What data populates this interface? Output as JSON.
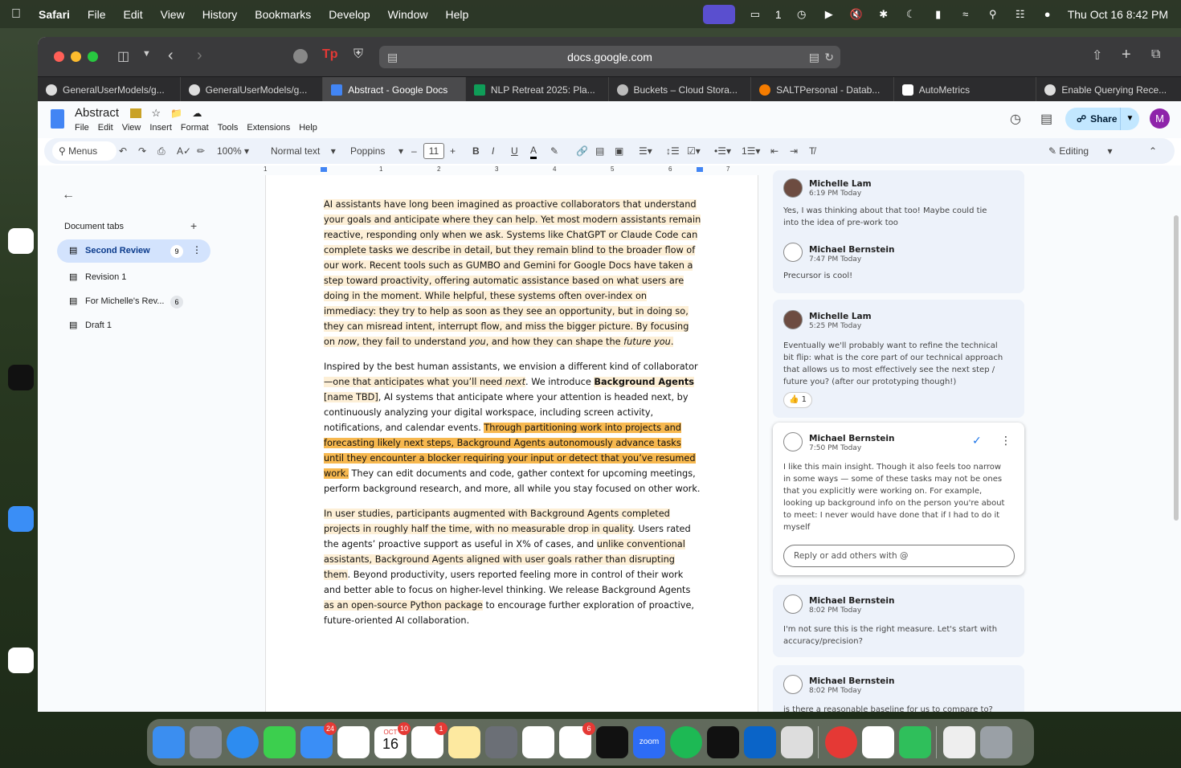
{
  "menubar": {
    "app": "Safari",
    "items": [
      "File",
      "Edit",
      "View",
      "History",
      "Bookmarks",
      "Develop",
      "Window",
      "Help"
    ],
    "clock": "Thu Oct 16  8:42 PM",
    "counter": "1"
  },
  "browser": {
    "url": "docs.google.com",
    "tabs": [
      {
        "label": "GeneralUserModels/g...",
        "icon": "github-icon"
      },
      {
        "label": "GeneralUserModels/g...",
        "icon": "github-icon"
      },
      {
        "label": "Abstract - Google Docs",
        "icon": "docs-icon",
        "active": true
      },
      {
        "label": "NLP Retreat 2025: Pla...",
        "icon": "sheets-icon"
      },
      {
        "label": "Buckets – Cloud Stora...",
        "icon": "cloud-icon"
      },
      {
        "label": "SALTPersonal - Datab...",
        "icon": "fire-icon"
      },
      {
        "label": "AutoMetrics",
        "icon": "autometrics-icon"
      },
      {
        "label": "Enable Querying Rece...",
        "icon": "github-icon"
      }
    ]
  },
  "doc": {
    "title": "Abstract",
    "menu": [
      "File",
      "Edit",
      "View",
      "Insert",
      "Format",
      "Tools",
      "Extensions",
      "Help"
    ],
    "share": "Share",
    "avatar": "M"
  },
  "toolbar": {
    "search": "Menus",
    "zoom": "100%",
    "style": "Normal text",
    "font": "Poppins",
    "size": "11",
    "mode": "Editing"
  },
  "ruler": {
    "marks": [
      "1",
      "1",
      "2",
      "3",
      "4",
      "5",
      "6",
      "7"
    ]
  },
  "sidebar": {
    "title": "Document tabs",
    "add": "+",
    "tabs": [
      {
        "label": "Second Review",
        "count": "9",
        "active": true
      },
      {
        "label": "Revision 1",
        "count": ""
      },
      {
        "label": "For Michelle's Rev...",
        "count": "6"
      },
      {
        "label": "Draft 1",
        "count": ""
      }
    ]
  },
  "content": {
    "p1": "AI assistants have long been imagined as proactive collaborators that understand your goals and anticipate where they can help. Yet most modern assistants remain reactive, responding only when we ask. Systems like ChatGPT or Claude Code can complete tasks we describe in detail, but they remain blind to the broader flow of our work. Recent tools such as GUMBO and Gemini for Google Docs have taken a step toward proactivity, offering automatic assistance based on what users are doing in the moment. While helpful, these systems often over-index on immediacy: they try to help as soon as they see an opportunity, but in doing so, they can misread intent, interrupt flow, and miss the bigger picture. By focusing on ",
    "p1_now": "now",
    "p1_b": ", they fail to understand ",
    "p1_you": "you",
    "p1_c": ", and how they can shape the ",
    "p1_future": "future you",
    "p1_end": ".",
    "p2_a": "Inspired by the best human assistants, we envision a different kind of collaborator",
    "p2_b": "—one that anticipates what you’ll need ",
    "p2_next": "next",
    "p2_c": ". We introduce ",
    "p2_bold": "Background Agents",
    "p2_d": " ",
    "p2_tbd": "[name TBD]",
    "p2_e": ", AI systems that anticipate where your attention is headed next, by continuously analyzing your digital workspace, including screen activity, notifications, and calendar events. ",
    "p2_hl": "Through partitioning work into projects and forecasting likely next steps, Background Agents autonomously advance tasks until they encounter a blocker requiring your input or detect that you’ve resumed work.",
    "p2_f": " They can edit documents and code, gather context for upcoming meetings, perform background research, and more, all while you stay focused on other work.",
    "p3_a": "In user studies, participants augmented with Background Agents completed projects in roughly half the time, with no measurable drop in quality",
    "p3_b": ". Users rated the agents’ proactive support as useful in X% of cases, and ",
    "p3_c": "unlike conventional assistants, Background Agents aligned with user goals rather than disrupting them",
    "p3_d": ". Beyond productivity, users reported feeling more in control of their work and better able to focus on higher-level thinking. We release Background Agents ",
    "p3_e": "as an open-source Python package",
    "p3_f": " to encourage further exploration of proactive, future-oriented AI collaboration."
  },
  "comments": [
    {
      "name": "Michelle Lam",
      "time": "6:19 PM Today",
      "text": "Yes, I was thinking about that too! Maybe could tie into the idea of pre-work too"
    },
    {
      "name": "Michael Bernstein",
      "time": "7:47 PM Today",
      "text": "Precursor is cool!"
    },
    {
      "name": "Michelle Lam",
      "time": "5:25 PM Today",
      "text": "Eventually we'll probably want to refine the technical bit flip: what is the core part of our technical approach that allows us to most effectively see the next step / future you? (after our prototyping though!)",
      "reaction": "👍 1"
    },
    {
      "name": "Michael Bernstein",
      "time": "7:50 PM Today",
      "text": "I like this main insight. Though it also feels too narrow in some ways — some of these tasks may not be ones that you explicitly were working on. For example, looking up background info on the person you're about to meet: I never would have done that if I had to do it myself",
      "reply": "Reply or add others with @"
    },
    {
      "name": "Michael Bernstein",
      "time": "8:02 PM Today",
      "text": "I'm not sure this is the right measure. Let's start with accuracy/precision?"
    },
    {
      "name": "Michael Bernstein",
      "time": "8:02 PM Today",
      "text": "is there a reasonable baseline for us to compare to?"
    }
  ],
  "dock": {
    "mail_badge": "24",
    "calendar_month": "OCT",
    "calendar_day": "16",
    "calendar_badge": "10",
    "reminders_badge": "1",
    "slack_badge": "6",
    "zoom_label": "zoom"
  },
  "colors": {
    "highlight_light": "#fdefd6",
    "highlight_strong": "#f7b84f",
    "share_bg": "#c2e7ff",
    "avatar": "#8e24aa"
  }
}
